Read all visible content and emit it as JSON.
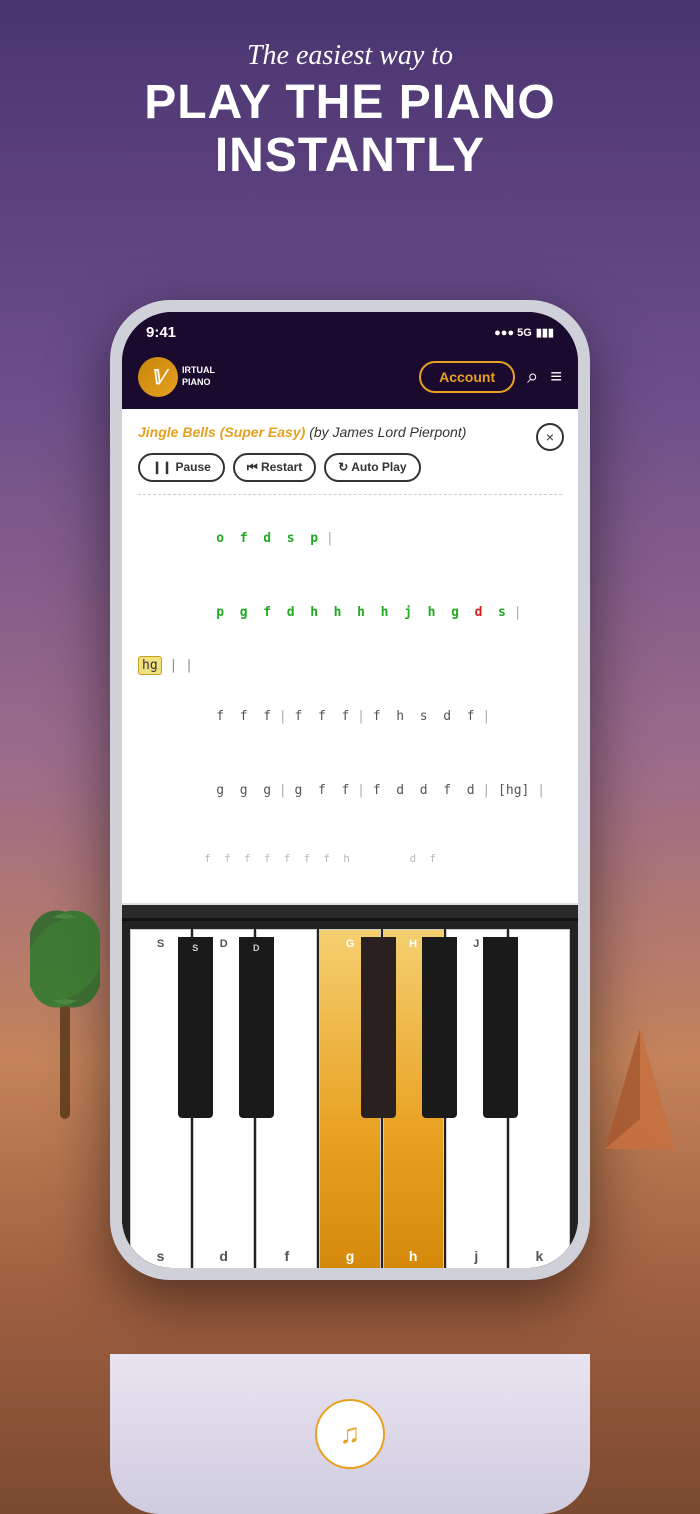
{
  "background": {
    "colors": {
      "sky_top": "#4a3570",
      "sky_mid": "#9b6b8a",
      "sunset": "#c4835a",
      "ground": "#7a4a30"
    }
  },
  "header": {
    "subtitle": "The easiest way to",
    "title_line1": "PLAY THE PIANO",
    "title_line2": "INSTANTLY"
  },
  "status_bar": {
    "time": "9:41",
    "signal": "●●● 5G",
    "battery": "▮▮▮"
  },
  "navbar": {
    "logo_text": "IRTUAL\nPIANO",
    "account_label": "Account",
    "search_label": "⌕",
    "menu_label": "≡"
  },
  "song": {
    "title": "Jingle Bells (Super Easy)",
    "author": "(by James Lord Pierpont)",
    "close_label": "×",
    "controls": {
      "pause": "❙❙ Pause",
      "restart": "⏮ Restart",
      "autoplay": "↻ Auto Play"
    }
  },
  "sheet_music": {
    "rows": [
      "o  f  d  s  p |",
      "p  g  f  d  h  h  h  h  j  h  g  d  s |",
      "[ hg ] |",
      "f  f  f | f  f  f | f  h  s  d  f |",
      "g  g  g | g  f  f | f  d  d  f  d | [ hg ] |",
      "f  f  f  f  f  f  f  h  s  d  f"
    ]
  },
  "piano": {
    "white_keys": [
      {
        "label_bottom": "s",
        "label_top": "S",
        "highlight": false
      },
      {
        "label_bottom": "d",
        "label_top": "D",
        "highlight": false
      },
      {
        "label_bottom": "f",
        "label_top": "",
        "highlight": false
      },
      {
        "label_bottom": "g",
        "label_top": "G",
        "highlight": true
      },
      {
        "label_bottom": "h",
        "label_top": "H",
        "highlight": true
      },
      {
        "label_bottom": "j",
        "label_top": "J",
        "highlight": false
      },
      {
        "label_bottom": "k",
        "label_top": "",
        "highlight": false
      }
    ],
    "black_keys": [
      {
        "label_bottom": "",
        "label_top": "S",
        "position_pct": 11
      },
      {
        "label_bottom": "",
        "label_top": "D",
        "position_pct": 25
      },
      {
        "label_bottom": "",
        "label_top": "",
        "position_pct": 53
      },
      {
        "label_bottom": "",
        "label_top": "",
        "position_pct": 67
      },
      {
        "label_bottom": "",
        "label_top": "",
        "position_pct": 81
      }
    ]
  },
  "bottom": {
    "music_icon": "♫"
  }
}
